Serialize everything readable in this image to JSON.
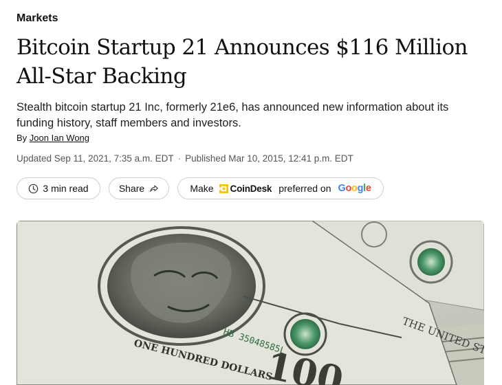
{
  "article": {
    "section": "Markets",
    "headline": "Bitcoin Startup 21 Announces $116 Million All-Star Backing",
    "dek": "Stealth bitcoin startup 21 Inc, formerly 21e6, has announced new information about its funding history, staff members and investors.",
    "byline_prefix": "By",
    "author": "Joon Ian Wong",
    "updated": "Updated Sep 11, 2021, 7:35 a.m. EDT",
    "separator": "·",
    "published": "Published Mar 10, 2015, 12:41 p.m. EDT"
  },
  "actions": {
    "read_time": "3 min read",
    "share_label": "Share",
    "make_label": "Make",
    "brand_name": "CoinDesk",
    "preferred_label": "preferred on",
    "google_letters": [
      "G",
      "o",
      "o",
      "g",
      "l",
      "e"
    ]
  },
  "hero_image": {
    "note_serial": "HB 35048585L",
    "note_text_upper": "THE UNITED STATES OF AMERICA",
    "note_text_lower": "ONE HUNDRED DOLLARS",
    "note_value": "100"
  },
  "colors": {
    "brand_yellow": "#F2C314",
    "google_blue": "#4285F4",
    "google_red": "#EA4335",
    "google_yellow": "#FBBC05",
    "google_green": "#34A853"
  },
  "icons": [
    "clock-icon",
    "share-arrow-icon",
    "coindesk-logo-icon"
  ]
}
